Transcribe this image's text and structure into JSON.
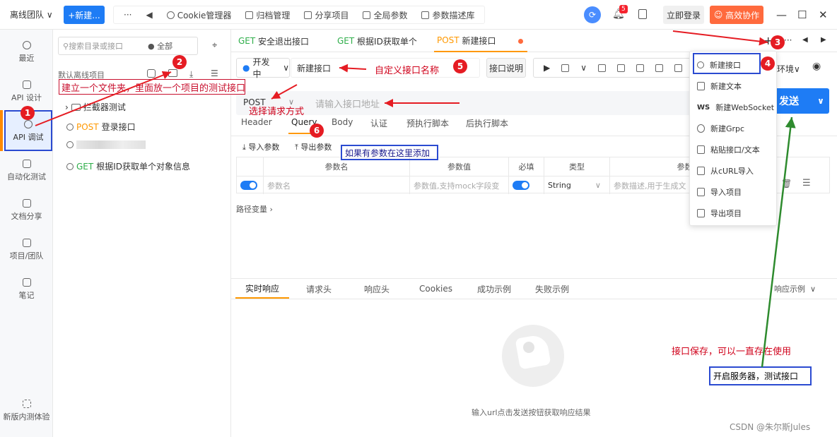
{
  "topbar": {
    "team": "离线团队 ∨",
    "new_button": "+新建...",
    "more": "···",
    "back": "◀",
    "nav": [
      {
        "label": "Cookie管理器",
        "icon": "cookie-icon"
      },
      {
        "label": "归档管理",
        "icon": "archive-icon"
      },
      {
        "label": "分享项目",
        "icon": "share-icon"
      },
      {
        "label": "全局参数",
        "icon": "params-icon"
      },
      {
        "label": "参数描述库",
        "icon": "cube-icon"
      }
    ],
    "bell_count": "5",
    "login": "立即登录",
    "collab": "高效协作"
  },
  "leftnav": {
    "items": [
      {
        "label": "最近",
        "icon": "clock-icon"
      },
      {
        "label": "API 设计",
        "icon": "edit-icon"
      },
      {
        "label": "API 调试",
        "icon": "link-icon"
      },
      {
        "label": "自动化测试",
        "icon": "flow-icon"
      },
      {
        "label": "文档分享",
        "icon": "doc-icon"
      },
      {
        "label": "项目/团队",
        "icon": "folder-icon"
      },
      {
        "label": "笔记",
        "icon": "note-icon"
      },
      {
        "label": "新版内测体验",
        "icon": "beta-icon"
      }
    ]
  },
  "tree": {
    "search_placeholder": "搜索目录或接口",
    "filter": "● 全部",
    "project": "默认离线项目",
    "items": [
      {
        "label": "拦截器测试",
        "method": ""
      },
      {
        "label": "登录接口",
        "method": "POST"
      },
      {
        "label": "",
        "method": ""
      },
      {
        "label": "根据ID获取单个对象信息",
        "method": "GET"
      }
    ]
  },
  "tabs": [
    {
      "method": "GET",
      "label": "安全退出接口"
    },
    {
      "method": "GET",
      "label": "根据ID获取单个"
    },
    {
      "method": "POST",
      "label": "新建接口"
    }
  ],
  "toolbar": {
    "status": "开发中",
    "name": "新建接口",
    "doc_button": "接口说明",
    "env": "环境"
  },
  "request": {
    "method": "POST",
    "url_placeholder": "请输入接口地址",
    "send": "发送"
  },
  "subtabs": [
    "Header",
    "Query",
    "Body",
    "认证",
    "预执行脚本",
    "后执行脚本"
  ],
  "params": {
    "import": "导入参数",
    "export": "导出参数",
    "headers": [
      "参数名",
      "参数值",
      "必填",
      "类型",
      "参数"
    ],
    "row": {
      "name_placeholder": "参数名",
      "value_placeholder": "参数值,支持mock字段变",
      "type": "String",
      "desc_placeholder": "参数描述,用于生成文"
    },
    "path_vars": "路径变量"
  },
  "response": {
    "tabs": [
      "实时响应",
      "请求头",
      "响应头",
      "Cookies",
      "成功示例",
      "失败示例"
    ],
    "example": "响应示例",
    "empty": "输入url点击发送按钮获取响应结果"
  },
  "dropdown": [
    {
      "label": "新建接口",
      "icon": "link-icon"
    },
    {
      "label": "新建文本",
      "icon": "text-icon"
    },
    {
      "label": "新建WebSocket",
      "icon": "ws-icon"
    },
    {
      "label": "新建Grpc",
      "icon": "grpc-icon"
    },
    {
      "label": "粘贴接口/文本",
      "icon": "paste-icon"
    },
    {
      "label": "从cURL导入",
      "icon": "curl-icon"
    },
    {
      "label": "导入项目",
      "icon": "import-icon"
    },
    {
      "label": "导出项目",
      "icon": "export-icon"
    }
  ],
  "annotations": {
    "folder_tip": "建立一个文件夹，里面放一个项目的测试接口",
    "method_tip": "选择请求方式",
    "name_tip": "自定义接口名称",
    "param_tip": "如果有参数在这里添加",
    "save_tip": "接口保存，可以一直存在使用",
    "server_tip": "开启服务器，测试接口",
    "nums": [
      "1",
      "2",
      "3",
      "4",
      "5",
      "6"
    ]
  },
  "watermark": "CSDN @朱尔斯Jules"
}
